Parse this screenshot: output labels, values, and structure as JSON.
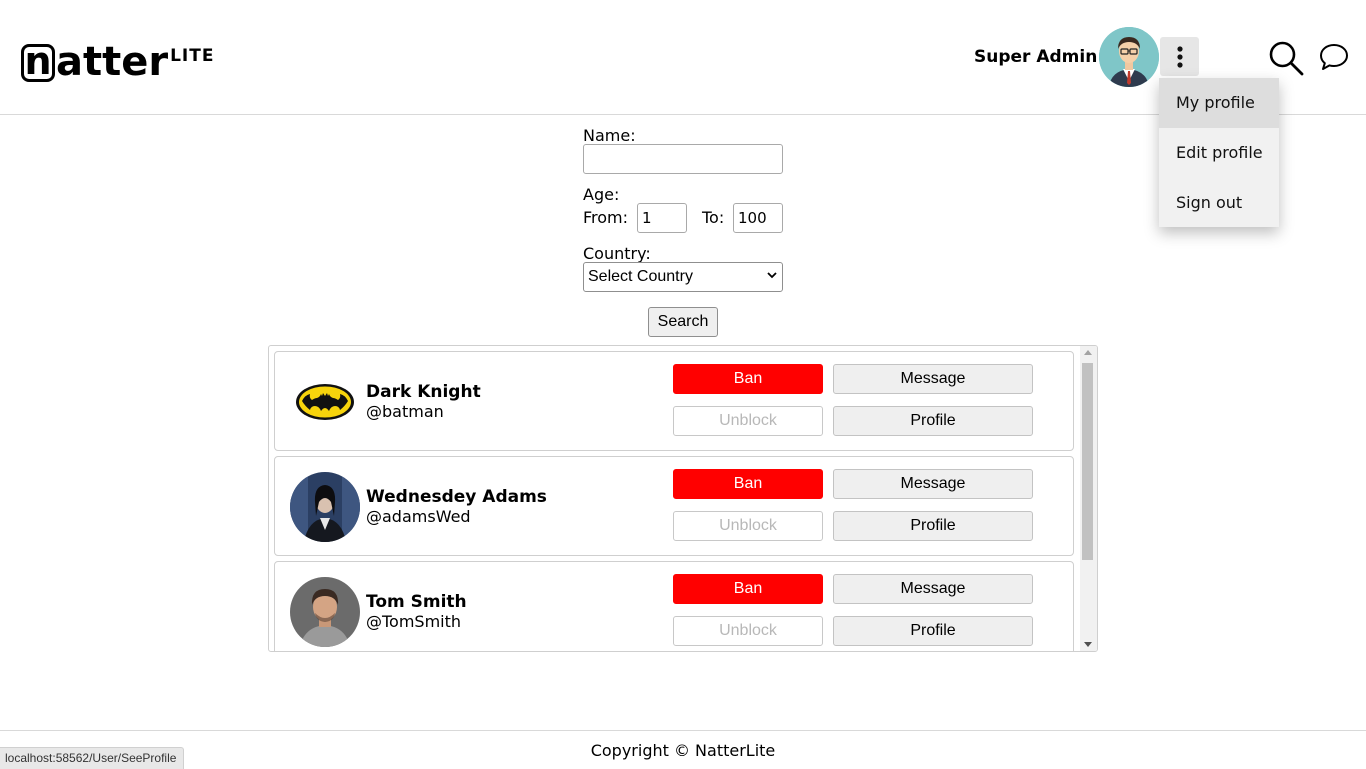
{
  "header": {
    "logo_letter": "n",
    "logo_rest": "atter",
    "logo_suffix": "LITE",
    "username": "Super Admin"
  },
  "menu": {
    "items": [
      {
        "label": "My profile",
        "active": true
      },
      {
        "label": "Edit profile",
        "active": false
      },
      {
        "label": "Sign out",
        "active": false
      }
    ]
  },
  "search_form": {
    "name_label": "Name:",
    "name_value": "",
    "age_label": "Age:",
    "from_label": "From:",
    "from_value": "1",
    "to_label": "To:",
    "to_value": "100",
    "country_label": "Country:",
    "country_selected": "Select Country",
    "search_button": "Search"
  },
  "users": [
    {
      "name": "Dark Knight",
      "handle": "@batman",
      "avatar": "batman-logo"
    },
    {
      "name": "Wednesdey Adams",
      "handle": "@adamsWed",
      "avatar": "wednesday-photo"
    },
    {
      "name": "Tom Smith",
      "handle": "@TomSmith",
      "avatar": "tom-photo"
    }
  ],
  "card_buttons": {
    "ban": "Ban",
    "unblock": "Unblock",
    "message": "Message",
    "profile": "Profile"
  },
  "footer": {
    "copyright": "Copyright © NatterLite"
  },
  "status_bar": {
    "url": "localhost:58562/User/SeeProfile"
  },
  "colors": {
    "ban": "#ff0000",
    "menu_bg": "#f1f1f1",
    "menu_active": "#dddddd"
  }
}
